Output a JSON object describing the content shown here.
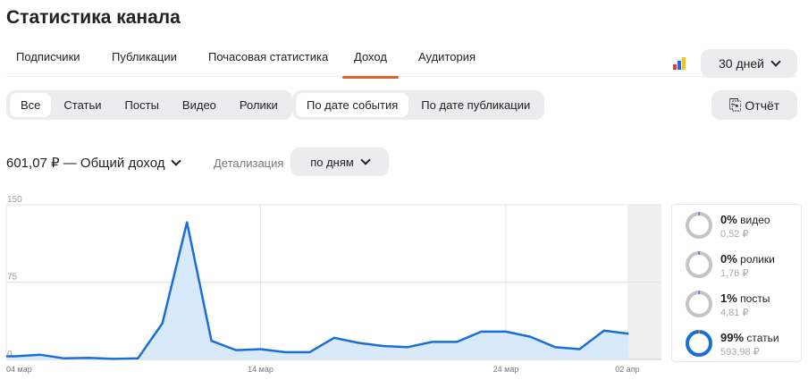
{
  "title": "Статистика канала",
  "tabs": [
    "Подписчики",
    "Публикации",
    "Почасовая статистика",
    "Доход",
    "Аудитория"
  ],
  "active_tab": "Доход",
  "period": "30 дней",
  "content_filters": [
    "Все",
    "Статьи",
    "Посты",
    "Видео",
    "Ролики"
  ],
  "date_filters": [
    "По дате события",
    "По дате публикации"
  ],
  "report_label": "Отчёт",
  "total": "601,07 ₽ — Общий доход",
  "detail_label": "Детализация",
  "detail_value": "по дням",
  "legend": [
    {
      "pct": "0%",
      "name": "видео",
      "amount": "0,52 ₽",
      "fraction": 0.001
    },
    {
      "pct": "0%",
      "name": "ролики",
      "amount": "1,76 ₽",
      "fraction": 0.003
    },
    {
      "pct": "1%",
      "name": "посты",
      "amount": "4,81 ₽",
      "fraction": 0.008
    },
    {
      "pct": "99%",
      "name": "статьи",
      "amount": "593,98 ₽",
      "fraction": 0.988
    }
  ],
  "chart_data": {
    "type": "area",
    "yticks": [
      "0",
      "75",
      "150"
    ],
    "ylim": [
      0,
      150
    ],
    "xticks": [
      "04 мар",
      "14 мар",
      "24 мар",
      "02 апр"
    ],
    "x_start": "04 мар",
    "values": [
      3,
      4.6,
      1,
      1.5,
      0.5,
      1,
      35,
      133,
      18,
      9,
      10,
      7,
      7,
      21,
      16,
      13,
      12,
      17,
      17,
      27,
      27,
      22,
      12,
      10,
      28,
      25
    ],
    "line_color": "#1a6fd6",
    "fill_color": "#d7e9fb"
  }
}
